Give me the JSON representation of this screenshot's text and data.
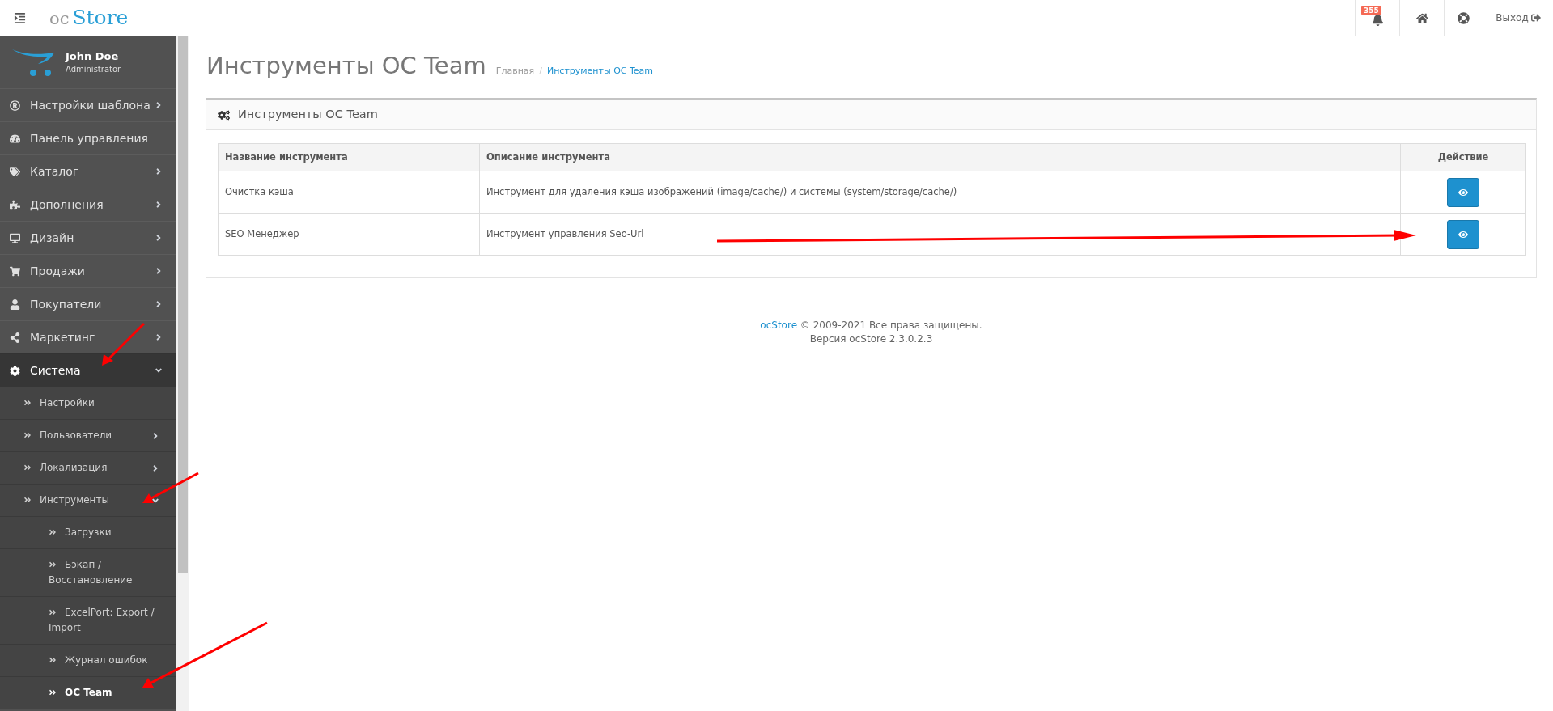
{
  "header": {
    "logo_prefix": "oc",
    "logo_main": "Store",
    "notification_count": "355",
    "logout": "Выход"
  },
  "user": {
    "name": "John Doe",
    "role": "Administrator"
  },
  "sidebar": {
    "items": [
      {
        "label": "Настройки шаблона",
        "expanded": false,
        "selected": false
      },
      {
        "label": "Панель управления",
        "selected": false
      },
      {
        "label": "Каталог",
        "expanded": false,
        "selected": false
      },
      {
        "label": "Дополнения",
        "expanded": false,
        "selected": false
      },
      {
        "label": "Дизайн",
        "expanded": false,
        "selected": false
      },
      {
        "label": "Продажи",
        "expanded": false,
        "selected": false
      },
      {
        "label": "Покупатели",
        "expanded": false,
        "selected": false
      },
      {
        "label": "Маркетинг",
        "expanded": false,
        "selected": false
      },
      {
        "label": "Система",
        "expanded": true,
        "selected": false,
        "children": [
          {
            "label": "Настройки",
            "selected": false
          },
          {
            "label": "Пользователи",
            "expanded": false,
            "selected": false
          },
          {
            "label": "Локализация",
            "expanded": false,
            "selected": false
          },
          {
            "label": "Инструменты",
            "expanded": true,
            "selected": false,
            "children": [
              {
                "label": "Загрузки",
                "selected": false
              },
              {
                "label": "Бэкап / Восстановление",
                "selected": false
              },
              {
                "label": "ExcelPort: Export / Import",
                "selected": false
              },
              {
                "label": "Журнал ошибок",
                "selected": false
              },
              {
                "label": "OC Team",
                "selected": true
              }
            ]
          }
        ]
      }
    ]
  },
  "page": {
    "title": "Инструменты OC Team",
    "breadcrumbs": [
      "Главная",
      "Инструменты OC Team"
    ],
    "breadcrumb_separator": "/"
  },
  "panel": {
    "title": "Инструменты OC Team"
  },
  "table": {
    "columns": [
      "Название инструмента",
      "Описание инструмента",
      "Действие"
    ],
    "rows": [
      {
        "name": "Очистка кэша",
        "description": "Инструмент для удаления кэша изображений (image/cache/) и системы (system/storage/cache/)"
      },
      {
        "name": "SEO Менеджер",
        "description": "Инструмент управления Seo-Url"
      }
    ]
  },
  "footer": {
    "brand": "ocStore",
    "copyright": "© 2009-2021 Все права защищены.",
    "version": "Версия ocStore 2.3.0.2.3"
  }
}
